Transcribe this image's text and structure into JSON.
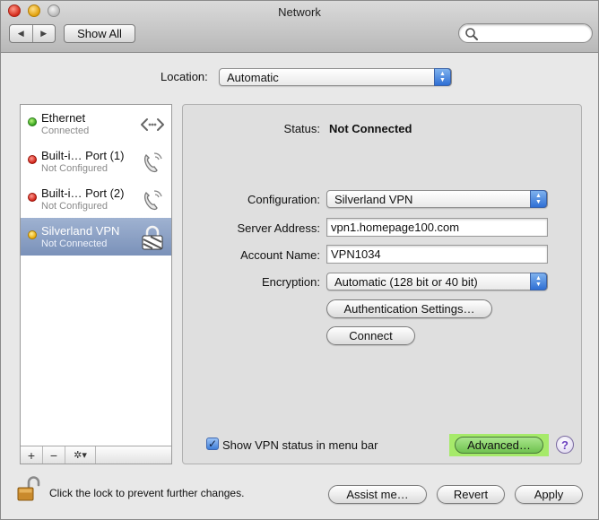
{
  "window": {
    "title": "Network"
  },
  "toolbar": {
    "back_glyph": "◀",
    "forward_glyph": "▶",
    "show_all": "Show All",
    "search_placeholder": ""
  },
  "location": {
    "label": "Location:",
    "value": "Automatic"
  },
  "services": [
    {
      "name": "Ethernet",
      "status": "Connected",
      "dot": "green",
      "icon": "ethernet-icon"
    },
    {
      "name": "Built-i… Port (1)",
      "status": "Not Configured",
      "dot": "red",
      "icon": "phone-icon"
    },
    {
      "name": "Built-i… Port (2)",
      "status": "Not Configured",
      "dot": "red",
      "icon": "phone-icon"
    },
    {
      "name": "Silverland VPN",
      "status": "Not Connected",
      "dot": "yellow",
      "icon": "vpn-lock-icon"
    }
  ],
  "sidebar_controls": {
    "add": "+",
    "remove": "−",
    "gear": "✲▾"
  },
  "detail": {
    "status_label": "Status:",
    "status_value": "Not Connected",
    "configuration_label": "Configuration:",
    "configuration_value": "Silverland VPN",
    "server_label": "Server Address:",
    "server_value": "vpn1.homepage100.com",
    "account_label": "Account Name:",
    "account_value": "VPN1034",
    "encryption_label": "Encryption:",
    "encryption_value": "Automatic (128 bit or 40 bit)",
    "auth_button": "Authentication Settings…",
    "connect_button": "Connect",
    "show_status_label": "Show VPN status in menu bar",
    "show_status_checked": true,
    "advanced_button": "Advanced…",
    "help": "?"
  },
  "footer": {
    "lock_text": "Click the lock to prevent further changes.",
    "assist": "Assist me…",
    "revert": "Revert",
    "apply": "Apply"
  },
  "colors": {
    "highlight": "#a6ea6a",
    "selection": "#7a91b9"
  }
}
